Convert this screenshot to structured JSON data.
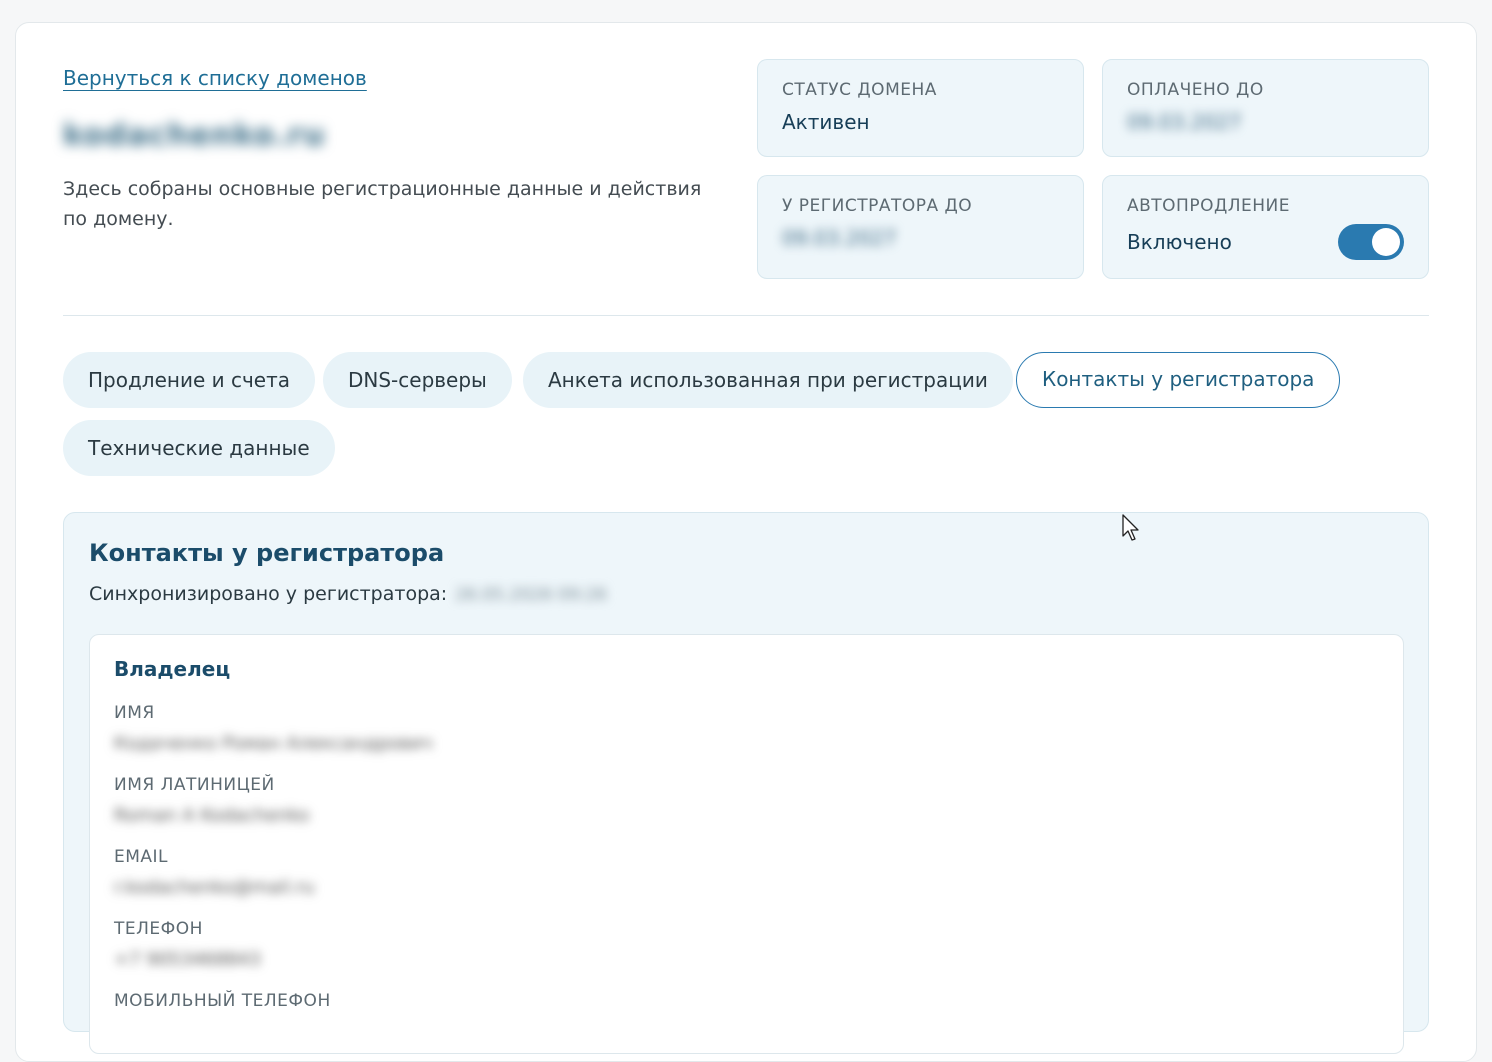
{
  "header": {
    "back_link": "Вернуться к списку доменов",
    "domain_name": "kodachenko.ru",
    "intro": "Здесь собраны основные регистрационные данные и действия по домену."
  },
  "status_cards": {
    "status": {
      "label": "СТАТУС ДОМЕНА",
      "value": "Активен"
    },
    "paid_until": {
      "label": "ОПЛАЧЕНО ДО",
      "value": "09.03.2027"
    },
    "registrar_until": {
      "label": "У РЕГИСТРАТОРА ДО",
      "value": "09.03.2027"
    },
    "autorenew": {
      "label": "АВТОПРОДЛЕНИЕ",
      "value": "Включено",
      "enabled": true
    }
  },
  "tabs": [
    {
      "label": "Продление и счета",
      "active": false
    },
    {
      "label": "DNS-серверы",
      "active": false
    },
    {
      "label": "Анкета использованная при регистрации",
      "active": false
    },
    {
      "label": "Контакты у регистратора",
      "active": true
    },
    {
      "label": "Технические данные",
      "active": false
    }
  ],
  "panel": {
    "title": "Контакты у регистратора",
    "sync_label": "Синхронизировано у регистратора:",
    "sync_value": "26.05.2026 09:26",
    "owner": {
      "title": "Владелец",
      "fields": [
        {
          "label": "ИМЯ",
          "value": "Кодаченко Роман Александрович"
        },
        {
          "label": "ИМЯ ЛАТИНИЦЕЙ",
          "value": "Roman A Kodachenko"
        },
        {
          "label": "EMAIL",
          "value": "r.kodachenko@mail.ru"
        },
        {
          "label": "ТЕЛЕФОН",
          "value": "+7 9053468843"
        },
        {
          "label": "МОБИЛЬНЫЙ ТЕЛЕФОН",
          "value": ""
        }
      ]
    }
  },
  "colors": {
    "accent": "#2a7ab0",
    "card_bg": "#eef6fa",
    "title": "#1b4c6a"
  }
}
